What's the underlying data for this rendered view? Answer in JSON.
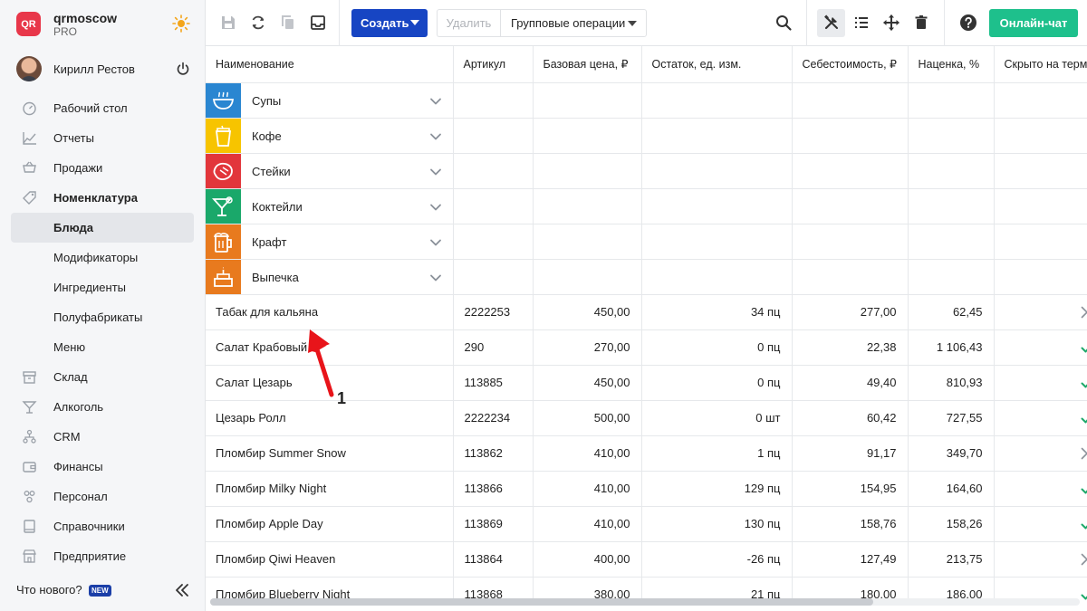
{
  "brand": {
    "logo": "QR",
    "name": "qrmoscow",
    "plan": "PRO"
  },
  "user": {
    "name": "Кирилл Рестов"
  },
  "nav": [
    {
      "label": "Рабочий стол",
      "icon": "dashboard-icon",
      "level": "top"
    },
    {
      "label": "Отчеты",
      "icon": "reports-icon",
      "level": "top"
    },
    {
      "label": "Продажи",
      "icon": "sales-icon",
      "level": "top"
    },
    {
      "label": "Номенклатура",
      "icon": "tag-icon",
      "level": "top",
      "bold": true
    },
    {
      "label": "Блюда",
      "level": "sub",
      "active": true
    },
    {
      "label": "Модификаторы",
      "level": "sub"
    },
    {
      "label": "Ингредиенты",
      "level": "sub"
    },
    {
      "label": "Полуфабрикаты",
      "level": "sub"
    },
    {
      "label": "Меню",
      "level": "sub"
    },
    {
      "label": "Склад",
      "icon": "warehouse-icon",
      "level": "top"
    },
    {
      "label": "Алкоголь",
      "icon": "cocktail-icon",
      "level": "top"
    },
    {
      "label": "CRM",
      "icon": "crm-icon",
      "level": "top"
    },
    {
      "label": "Финансы",
      "icon": "wallet-icon",
      "level": "top"
    },
    {
      "label": "Персонал",
      "icon": "people-icon",
      "level": "top"
    },
    {
      "label": "Справочники",
      "icon": "book-icon",
      "level": "top"
    },
    {
      "label": "Предприятие",
      "icon": "store-icon",
      "level": "top"
    }
  ],
  "footer": {
    "whats_new": "Что нового?",
    "new_badge": "NEW"
  },
  "toolbar": {
    "create": "Создать",
    "delete": "Удалить",
    "group_ops": "Групповые операции",
    "chat": "Онлайн-чат"
  },
  "table": {
    "columns": [
      "Наименование",
      "Артикул",
      "Базовая цена, ₽",
      "Остаток, ед. изм.",
      "Себестоимость, ₽",
      "Наценка, %",
      "Скрыто на терминале"
    ],
    "categories": [
      {
        "label": "Супы",
        "color": "#2a86d1",
        "icon": "soup-icon"
      },
      {
        "label": "Кофе",
        "color": "#f7c400",
        "icon": "coffee-icon"
      },
      {
        "label": "Стейки",
        "color": "#e2363b",
        "icon": "steak-icon"
      },
      {
        "label": "Коктейли",
        "color": "#1aa86a",
        "icon": "cocktail-icon"
      },
      {
        "label": "Крафт",
        "color": "#e87a1e",
        "icon": "beer-icon"
      },
      {
        "label": "Выпечка",
        "color": "#e87a1e",
        "icon": "cake-icon"
      }
    ],
    "rows": [
      {
        "name": "Табак для кальяна",
        "sku": "2222253",
        "price": "450,00",
        "stock": "34 пц",
        "cost": "277,00",
        "markup": "62,45",
        "hidden": "cross"
      },
      {
        "name": "Салат Крабовый",
        "sku": "290",
        "price": "270,00",
        "stock": "0 пц",
        "cost": "22,38",
        "markup": "1 106,43",
        "hidden": "check"
      },
      {
        "name": "Салат Цезарь",
        "sku": "113885",
        "price": "450,00",
        "stock": "0 пц",
        "cost": "49,40",
        "markup": "810,93",
        "hidden": "check"
      },
      {
        "name": "Цезарь Ролл",
        "sku": "2222234",
        "price": "500,00",
        "stock": "0 шт",
        "cost": "60,42",
        "markup": "727,55",
        "hidden": "check"
      },
      {
        "name": "Пломбир Summer Snow",
        "sku": "113862",
        "price": "410,00",
        "stock": "1 пц",
        "cost": "91,17",
        "markup": "349,70",
        "hidden": "cross"
      },
      {
        "name": "Пломбир Milky Night",
        "sku": "113866",
        "price": "410,00",
        "stock": "129 пц",
        "cost": "154,95",
        "markup": "164,60",
        "hidden": "check"
      },
      {
        "name": "Пломбир Apple Day",
        "sku": "113869",
        "price": "410,00",
        "stock": "130 пц",
        "cost": "158,76",
        "markup": "158,26",
        "hidden": "check"
      },
      {
        "name": "Пломбир Qiwi Heaven",
        "sku": "113864",
        "price": "400,00",
        "stock": "-26 пц",
        "cost": "127,49",
        "markup": "213,75",
        "hidden": "cross"
      },
      {
        "name": "Пломбир Blueberry Night",
        "sku": "113868",
        "price": "380,00",
        "stock": "21 пц",
        "cost": "180,00",
        "markup": "186,00",
        "hidden": "check"
      }
    ]
  },
  "annotation": {
    "number": "1"
  },
  "colors": {
    "primary": "#1745c3",
    "chat": "#1ec08c",
    "check": "#1ea86a",
    "cross": "#8a9099"
  }
}
